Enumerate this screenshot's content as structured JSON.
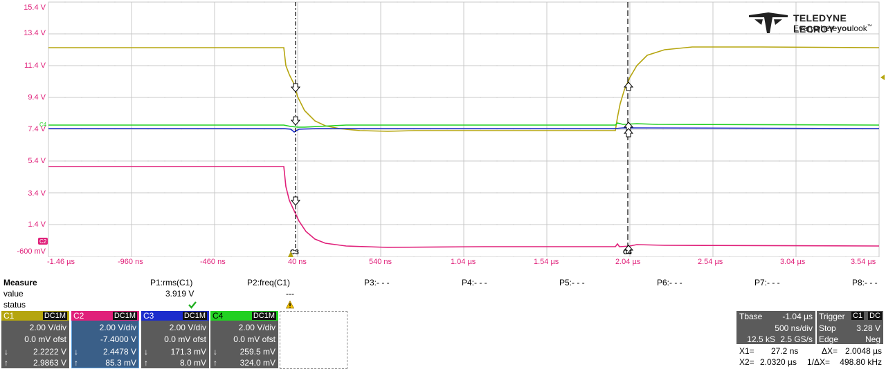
{
  "logo": {
    "brand": "TELEDYNE LECROY",
    "tagline_1": "Everywhere",
    "tagline_2": "you",
    "tagline_3": "look",
    "trademark": "™"
  },
  "y_axis_labels": [
    "15.4 V",
    "13.4 V",
    "11.4 V",
    "9.4 V",
    "7.4 V",
    "5.4 V",
    "3.4 V",
    "1.4 V",
    "-600 mV"
  ],
  "x_axis_labels": [
    "-1.46 µs",
    "-960 ns",
    "-460 ns",
    "40 ns",
    "540 ns",
    "1.04 µs",
    "1.54 µs",
    "2.04 µs",
    "2.54 µs",
    "3.04 µs",
    "3.54 µs"
  ],
  "markers": {
    "c3_cursor": "C3",
    "c4_cursor": "C4",
    "c2_ref": "C2",
    "c4_ref": "C4"
  },
  "measure": {
    "title": "Measure",
    "row_labels": [
      "value",
      "status"
    ],
    "params": [
      {
        "label": "P1:rms(C1)",
        "value": "3.919 V",
        "status": "ok"
      },
      {
        "label": "P2:freq(C1)",
        "value": "---",
        "status": "warning"
      },
      {
        "label": "P3:- - -",
        "value": "",
        "status": ""
      },
      {
        "label": "P4:- - -",
        "value": "",
        "status": ""
      },
      {
        "label": "P5:- - -",
        "value": "",
        "status": ""
      },
      {
        "label": "P6:- - -",
        "value": "",
        "status": ""
      },
      {
        "label": "P7:- - -",
        "value": "",
        "status": ""
      },
      {
        "label": "P8:- - -",
        "value": "",
        "status": ""
      }
    ]
  },
  "channels": [
    {
      "name": "C1",
      "coupling": "DC1M",
      "vdiv": "2.00 V/div",
      "offset": "0.0 mV ofst",
      "down": "2.2222 V",
      "up": "2.9863 V",
      "color": "#b5a50f"
    },
    {
      "name": "C2",
      "coupling": "DC1M",
      "vdiv": "2.00 V/div",
      "offset": "-7.4000 V",
      "down": "2.4478 V",
      "up": "85.3 mV",
      "color": "#e0207a"
    },
    {
      "name": "C3",
      "coupling": "DC1M",
      "vdiv": "2.00 V/div",
      "offset": "0.0 mV ofst",
      "down": "171.3 mV",
      "up": "8.0 mV",
      "color": "#1c2ccc"
    },
    {
      "name": "C4",
      "coupling": "DC1M",
      "vdiv": "2.00 V/div",
      "offset": "0.0 mV ofst",
      "down": "259.5 mV",
      "up": "324.0 mV",
      "color": "#22d022"
    }
  ],
  "arrows": {
    "down": "↓",
    "up": "↑"
  },
  "timebase": {
    "label": "Tbase",
    "delay": "-1.04 µs",
    "tdiv": "500 ns/div",
    "samples": "12.5 kS",
    "rate": "2.5 GS/s"
  },
  "trigger": {
    "label": "Trigger",
    "ch": "C1",
    "coupling": "DC",
    "mode": "Stop",
    "level": "3.28 V",
    "type": "Edge",
    "slope": "Neg"
  },
  "cursors": {
    "x1_label": "X1=",
    "x1": "27.2 ns",
    "dx_label": "ΔX=",
    "dx": "2.0048 µs",
    "x2_label": "X2=",
    "x2": "2.0320 µs",
    "inv_label": "1/ΔX=",
    "inv": "498.80 kHz"
  },
  "colors": {
    "axis_label": "#e0207a",
    "panel_bg": "#5b5b5b",
    "c1": "#b5a50f",
    "c2": "#e0207a",
    "c3": "#1c2ccc",
    "c4": "#22d022"
  }
}
